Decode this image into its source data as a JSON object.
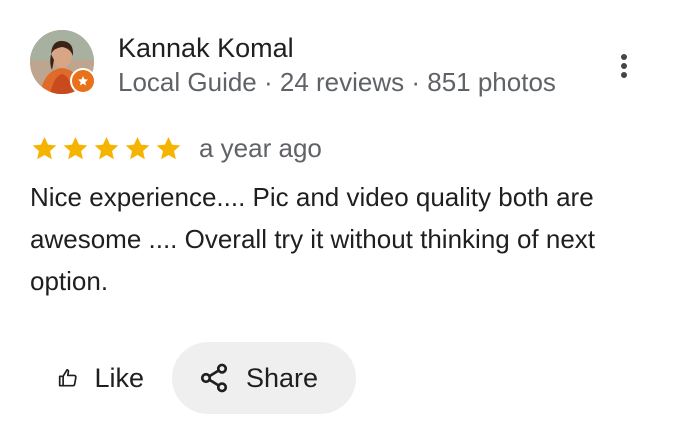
{
  "review": {
    "author": {
      "name": "Kannak Komal",
      "meta": "Local Guide · 24 reviews · 851 photos",
      "avatar_icon": "user-photo",
      "badge_icon": "local-guide-star-icon"
    },
    "rating": 5,
    "rating_max": 5,
    "age": "a year ago",
    "text": "Nice experience.... Pic and video quality both are awesome .... Overall try it without thinking of next option.",
    "more_icon": "more-vert-icon"
  },
  "actions": {
    "like_label": "Like",
    "like_icon": "thumb-up-icon",
    "share_label": "Share",
    "share_icon": "share-icon"
  },
  "colors": {
    "star": "#f4b400",
    "badge": "#e8711a",
    "secondary_text": "#5f6368",
    "share_bg": "#efefef"
  }
}
